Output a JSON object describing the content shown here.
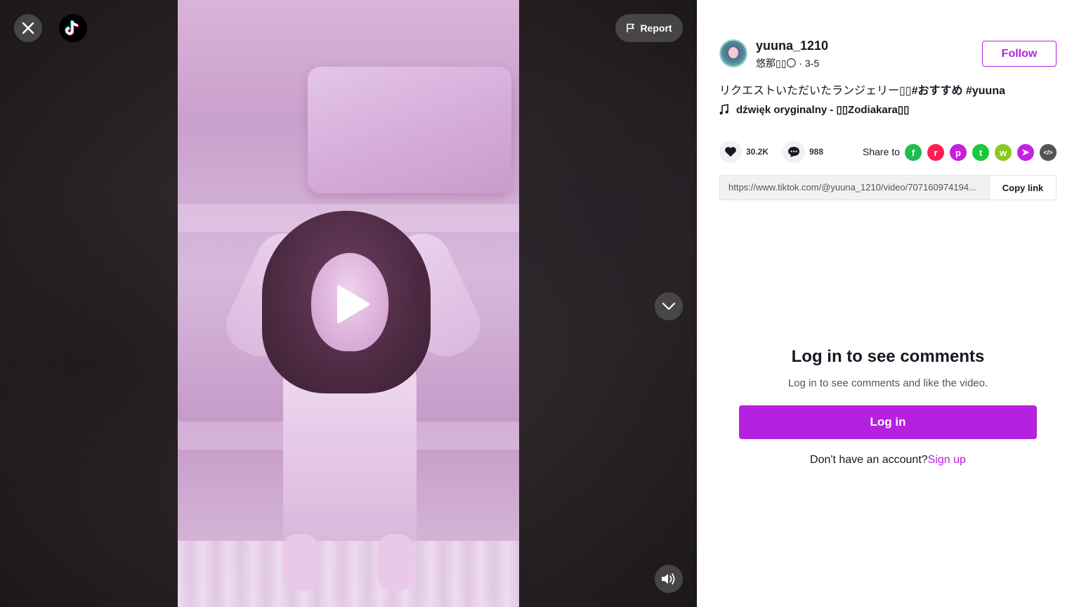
{
  "header": {
    "report_label": "Report"
  },
  "author": {
    "username": "yuuna_1210",
    "nickname": "悠那▯▯〇",
    "date": "3-5",
    "follow_label": "Follow"
  },
  "caption": {
    "text": "リクエストいただいたランジェリー▯▯",
    "tags": "#おすすめ #yuuna"
  },
  "music": {
    "title": "dźwięk oryginalny - ▯▯Zodiakara▯▯"
  },
  "stats": {
    "likes": "30.2K",
    "comments": "988"
  },
  "share": {
    "label": "Share to",
    "icons": [
      {
        "name": "facebook-icon",
        "color": "#1fbd4f",
        "glyph": "f"
      },
      {
        "name": "reddit-icon",
        "color": "#ff1e52",
        "glyph": "r"
      },
      {
        "name": "pinterest-icon",
        "color": "#c71edc",
        "glyph": "p"
      },
      {
        "name": "twitter-icon",
        "color": "#19c83b",
        "glyph": "t"
      },
      {
        "name": "whatsapp-icon",
        "color": "#88c923",
        "glyph": "w"
      },
      {
        "name": "telegram-icon",
        "color": "#c620e3",
        "glyph": "➤"
      },
      {
        "name": "embed-icon",
        "color": "#545454",
        "glyph": "</>"
      }
    ]
  },
  "link": {
    "url": "https://www.tiktok.com/@yuuna_1210/video/707160974194...",
    "copy_label": "Copy link"
  },
  "comments": {
    "title": "Log in to see comments",
    "subtitle": "Log in to see comments and like the video.",
    "login_label": "Log in",
    "no_account": "Don't have an account?",
    "signup_label": "Sign up"
  },
  "colors": {
    "accent": "#b620e0",
    "panel_bg": "#ffffff"
  }
}
